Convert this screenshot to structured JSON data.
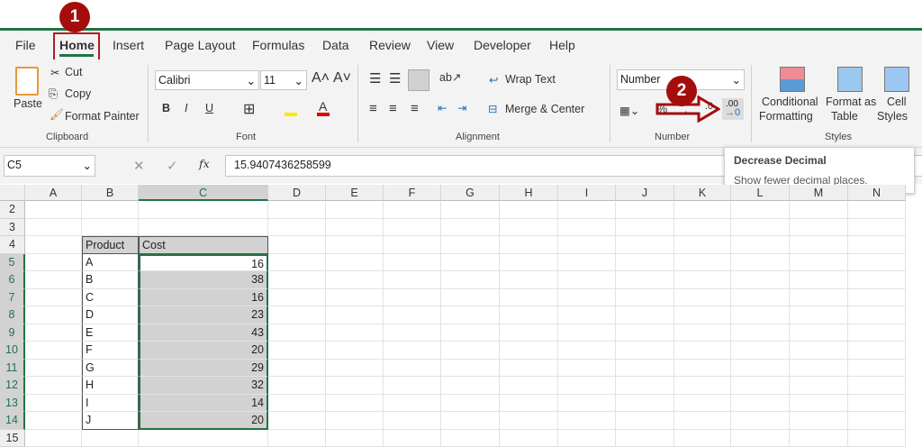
{
  "tabs": [
    "File",
    "Home",
    "Insert",
    "Page Layout",
    "Formulas",
    "Data",
    "Review",
    "View",
    "Developer",
    "Help"
  ],
  "badges": [
    "1",
    "2"
  ],
  "clipboard": {
    "paste": "Paste",
    "cut": "Cut",
    "copy": "Copy",
    "format_painter": "Format Painter",
    "group": "Clipboard"
  },
  "font": {
    "name": "Calibri",
    "size": "11",
    "bold": "B",
    "italic": "I",
    "underline": "U",
    "group": "Font"
  },
  "alignment": {
    "wrap": "Wrap Text",
    "merge": "Merge & Center",
    "group": "Alignment"
  },
  "number": {
    "format": "Number",
    "percent": "%",
    "comma": ",",
    "increase": ".0",
    "decrease": ".00",
    "group": "Number"
  },
  "styles": {
    "conditional": "Conditional",
    "conditional2": "Formatting",
    "format_table": "Format as",
    "format_table2": "Table",
    "cell_styles": "Cell",
    "cell_styles2": "Styles",
    "group": "Styles"
  },
  "formula_bar": {
    "name_box": "C5",
    "fx": "fx",
    "value": "15.9407436258599"
  },
  "tooltip": {
    "title": "Decrease Decimal",
    "body": "Show fewer decimal places."
  },
  "columns": [
    "A",
    "B",
    "C",
    "D",
    "E",
    "F",
    "G",
    "H",
    "I",
    "J",
    "K",
    "L",
    "M",
    "N"
  ],
  "rows": [
    "2",
    "3",
    "4",
    "5",
    "6",
    "7",
    "8",
    "9",
    "10",
    "11",
    "12",
    "13",
    "14",
    "15"
  ],
  "table": {
    "headers": [
      "Product",
      "Cost"
    ],
    "rows": [
      [
        "A",
        "16"
      ],
      [
        "B",
        "38"
      ],
      [
        "C",
        "16"
      ],
      [
        "D",
        "23"
      ],
      [
        "E",
        "43"
      ],
      [
        "F",
        "20"
      ],
      [
        "G",
        "29"
      ],
      [
        "H",
        "32"
      ],
      [
        "I",
        "14"
      ],
      [
        "J",
        "20"
      ]
    ]
  },
  "colors": {
    "accent": "#217346",
    "badge": "#a50d0d"
  }
}
